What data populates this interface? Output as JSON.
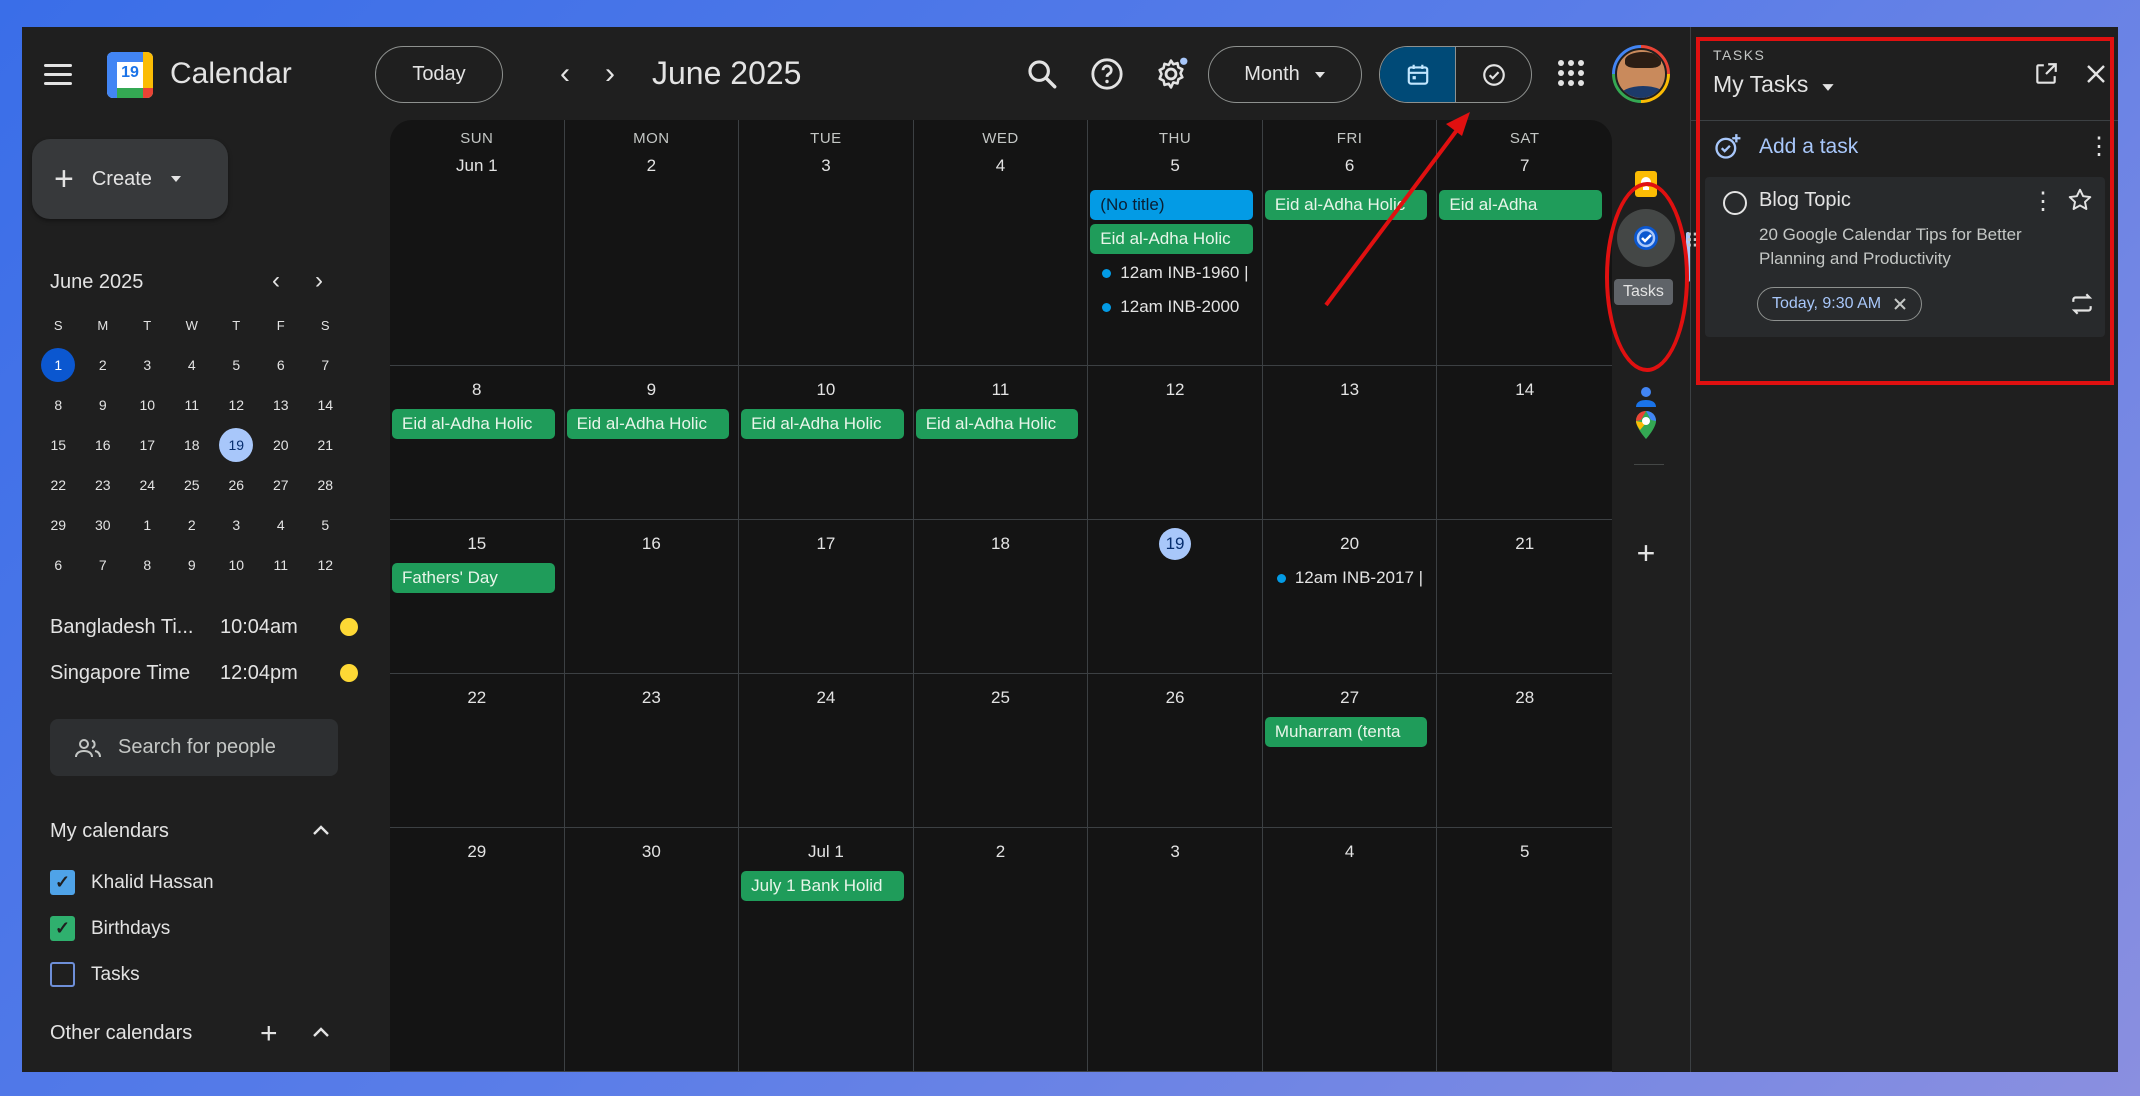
{
  "header": {
    "app_title": "Calendar",
    "logo_day": "19",
    "today_label": "Today",
    "month_title": "June 2025",
    "view_label": "Month"
  },
  "sidebar": {
    "create_label": "Create",
    "mini_title": "June 2025",
    "mini_dows": [
      "S",
      "M",
      "T",
      "W",
      "T",
      "F",
      "S"
    ],
    "mini_weeks": [
      [
        "1",
        "2",
        "3",
        "4",
        "5",
        "6",
        "7"
      ],
      [
        "8",
        "9",
        "10",
        "11",
        "12",
        "13",
        "14"
      ],
      [
        "15",
        "16",
        "17",
        "18",
        "19",
        "20",
        "21"
      ],
      [
        "22",
        "23",
        "24",
        "25",
        "26",
        "27",
        "28"
      ],
      [
        "29",
        "30",
        "1",
        "2",
        "3",
        "4",
        "5"
      ],
      [
        "6",
        "7",
        "8",
        "9",
        "10",
        "11",
        "12"
      ]
    ],
    "timezones": [
      {
        "name": "Bangladesh Ti...",
        "time": "10:04am"
      },
      {
        "name": "Singapore Time",
        "time": "12:04pm"
      }
    ],
    "search_people_placeholder": "Search for people",
    "my_calendars_title": "My calendars",
    "my_calendars": [
      {
        "label": "Khalid Hassan",
        "color": "#4fa3e8",
        "checked": true
      },
      {
        "label": "Birthdays",
        "color": "#2fb06e",
        "checked": true
      },
      {
        "label": "Tasks",
        "color": "#6e8fd8",
        "checked": false
      }
    ],
    "other_calendars_title": "Other calendars"
  },
  "grid": {
    "dows": [
      "SUN",
      "MON",
      "TUE",
      "WED",
      "THU",
      "FRI",
      "SAT"
    ],
    "weeks": [
      [
        "Jun 1",
        "2",
        "3",
        "4",
        "5",
        "6",
        "7"
      ],
      [
        "8",
        "9",
        "10",
        "11",
        "12",
        "13",
        "14"
      ],
      [
        "15",
        "16",
        "17",
        "18",
        "19",
        "20",
        "21"
      ],
      [
        "22",
        "23",
        "24",
        "25",
        "26",
        "27",
        "28"
      ],
      [
        "29",
        "30",
        "Jul 1",
        "2",
        "3",
        "4",
        "5"
      ]
    ],
    "today": "19",
    "events": [
      {
        "week": 0,
        "day": 4,
        "slot": 0,
        "style": "blue",
        "text": "(No title)"
      },
      {
        "week": 0,
        "day": 4,
        "slot": 1,
        "style": "green",
        "text": "Eid al-Adha Holic"
      },
      {
        "week": 0,
        "day": 4,
        "slot": 2,
        "style": "dot",
        "text": "12am INB-1960 |"
      },
      {
        "week": 0,
        "day": 4,
        "slot": 3,
        "style": "dot",
        "text": "12am INB-2000"
      },
      {
        "week": 0,
        "day": 5,
        "slot": 0,
        "style": "green",
        "text": "Eid al-Adha Holic"
      },
      {
        "week": 0,
        "day": 6,
        "slot": 0,
        "style": "green",
        "text": "Eid al-Adha"
      },
      {
        "week": 1,
        "day": 0,
        "slot": 0,
        "style": "green",
        "text": "Eid al-Adha Holic"
      },
      {
        "week": 1,
        "day": 1,
        "slot": 0,
        "style": "green",
        "text": "Eid al-Adha Holic"
      },
      {
        "week": 1,
        "day": 2,
        "slot": 0,
        "style": "green",
        "text": "Eid al-Adha Holic"
      },
      {
        "week": 1,
        "day": 3,
        "slot": 0,
        "style": "green",
        "text": "Eid al-Adha Holic"
      },
      {
        "week": 2,
        "day": 0,
        "slot": 0,
        "style": "green",
        "text": "Fathers' Day"
      },
      {
        "week": 2,
        "day": 5,
        "slot": 0,
        "style": "dot",
        "text": "12am INB-2017 |"
      },
      {
        "week": 3,
        "day": 5,
        "slot": 0,
        "style": "green",
        "text": "Muharram (tenta"
      },
      {
        "week": 4,
        "day": 2,
        "slot": 0,
        "style": "green",
        "text": "July 1 Bank Holid"
      }
    ]
  },
  "rail": {
    "tooltip": "Tasks"
  },
  "tasks_panel": {
    "label": "TASKS",
    "list_title": "My Tasks",
    "add_task_label": "Add a task",
    "task": {
      "title": "Blog Topic",
      "description": "20 Google Calendar Tips for Better Planning and Productivity",
      "due_chip": "Today, 9:30 AM"
    }
  },
  "colors": {
    "accent": "#a8c7fa",
    "event_green": "#1f9c5a",
    "event_blue": "#039be5",
    "annotation_red": "#e01010"
  }
}
